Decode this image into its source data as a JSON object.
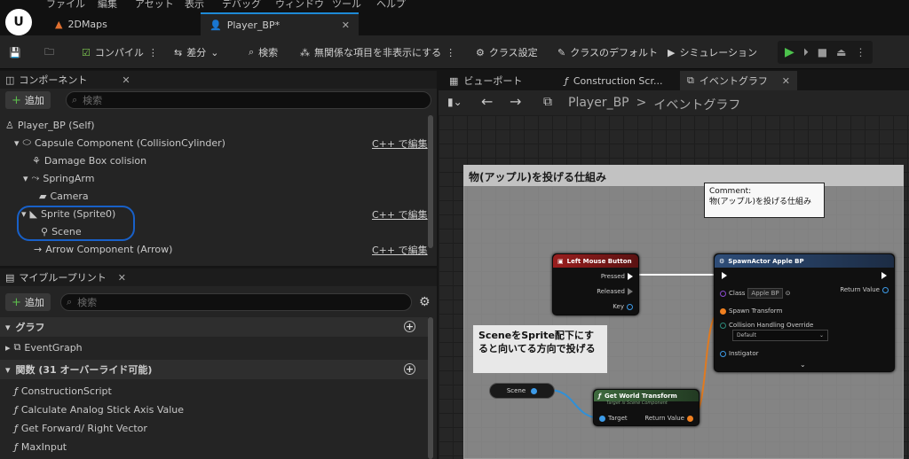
{
  "menubar": [
    "ファイル",
    "編集",
    "アセット",
    "表示",
    "デバッグ",
    "ウィンドウ",
    "ツール",
    "ヘルプ"
  ],
  "doc_tabs": [
    {
      "label": "2DMaps"
    },
    {
      "label": "Player_BP*"
    }
  ],
  "toolbar": {
    "compile": "コンパイル",
    "diff": "差分",
    "search": "検索",
    "hide_unrelated": "無関係な項目を非表示にする",
    "class_settings": "クラス設定",
    "class_defaults": "クラスのデフォルト",
    "simulation": "シミュレーション"
  },
  "components": {
    "title": "コンポーネント",
    "add": "追加",
    "search_placeholder": "検索",
    "items": [
      {
        "label": "Player_BP (Self)"
      },
      {
        "label": "Capsule Component (CollisionCylinder)",
        "cpp": "C++ で編集"
      },
      {
        "label": "Damage Box colision"
      },
      {
        "label": "SpringArm"
      },
      {
        "label": "Camera"
      },
      {
        "label": "Sprite (Sprite0)",
        "cpp": "C++ で編集"
      },
      {
        "label": "Scene"
      },
      {
        "label": "Arrow Component (Arrow)",
        "cpp": "C++ で編集"
      }
    ]
  },
  "my_blueprint": {
    "title": "マイブループリント",
    "add": "追加",
    "search_placeholder": "検索",
    "graph_section": "グラフ",
    "event_graph": "EventGraph",
    "functions_section": "関数 (31 オーバーライド可能)",
    "functions": [
      "ConstructionScript",
      "Calculate Analog Stick Axis Value",
      "Get Forward/ Right Vector",
      "MaxInput"
    ]
  },
  "graph_tabs": [
    {
      "label": "ビューポート"
    },
    {
      "label": "Construction Scr..."
    },
    {
      "label": "イベントグラフ"
    }
  ],
  "breadcrumb": {
    "bp": "Player_BP",
    "sep": ">",
    "graph": "イベントグラフ"
  },
  "comment": {
    "title": "物(アップル)を投げる仕組み",
    "tooltip_label": "Comment:",
    "tooltip_text": "物(アップル)を投げる仕組み"
  },
  "lmb_node": {
    "title": "Left Mouse Button",
    "pressed": "Pressed",
    "released": "Released",
    "key": "Key"
  },
  "spawn_node": {
    "title": "SpawnActor Apple BP",
    "class": "Class",
    "class_value": "Apple BP",
    "return": "Return Value",
    "spawn_transform": "Spawn Transform",
    "collision": "Collision Handling Override",
    "collision_value": "Default",
    "instigator": "Instigator"
  },
  "gwt_node": {
    "title": "Get World Transform",
    "subtitle": "Target is Scene Component",
    "target": "Target",
    "return": "Return Value"
  },
  "scene_var": "Scene",
  "note": "SceneをSprite配下にすると向いてる方向で投げる",
  "colors": {
    "accent": "#1e8ad6",
    "highlight": "#1860c8",
    "event_header": "#8c1a1a",
    "spawn_header": "#2e4d78",
    "func_header": "#3e6a3e"
  }
}
